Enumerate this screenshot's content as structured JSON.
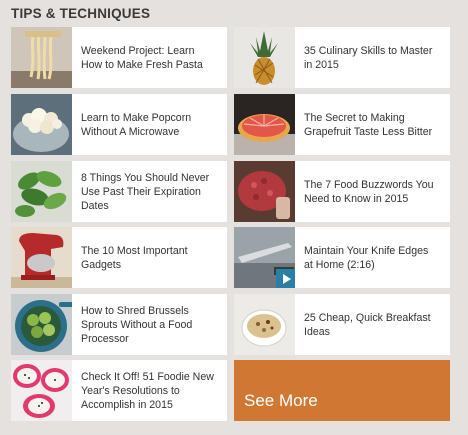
{
  "section": {
    "title": "TIPS & TECHNIQUES"
  },
  "articles": [
    {
      "title": "Weekend Project: Learn How to Make Fresh Pasta",
      "thumb": "pasta"
    },
    {
      "title": "35 Culinary Skills to Master in 2015",
      "thumb": "pineapple"
    },
    {
      "title": "Learn to Make Popcorn Without A Microwave",
      "thumb": "popcorn"
    },
    {
      "title": "The Secret to Making Grapefruit Taste Less Bitter",
      "thumb": "grapefruit"
    },
    {
      "title": "8 Things You Should Never Use Past Their Expiration Dates",
      "thumb": "greens"
    },
    {
      "title": "The 7 Food Buzzwords You Need to Know in 2015",
      "thumb": "ground-meat"
    },
    {
      "title": "The 10 Most Important Gadgets",
      "thumb": "stand-mixer"
    },
    {
      "title": "Maintain Your Knife Edges at Home (2:16)",
      "thumb": "knife",
      "video": true
    },
    {
      "title": "How to Shred Brussels Sprouts Without a Food Processor",
      "thumb": "brussels-sprouts"
    },
    {
      "title": "25 Cheap, Quick Breakfast Ideas",
      "thumb": "oatmeal"
    },
    {
      "title": "Check It Off! 51 Foodie New Year's Resolutions to Accomplish in 2015",
      "thumb": "dragonfruit"
    }
  ],
  "see_more": {
    "label": "See More"
  },
  "colors": {
    "accent": "#cf7733",
    "video_badge": "#2a7fa6",
    "background": "#e4e1de"
  }
}
